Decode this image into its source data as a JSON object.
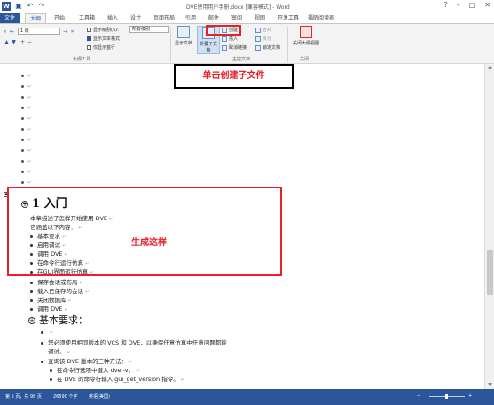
{
  "titlebar": {
    "title": "DVE使用用户手册.docx [兼容模式] - Word",
    "icons": [
      "save-icon",
      "undo-icon",
      "redo-icon"
    ]
  },
  "tabs": [
    "文件",
    "大纲",
    "开始",
    "工具箱",
    "插入",
    "设计",
    "页面布局",
    "引用",
    "邮件",
    "审阅",
    "视图",
    "开发工具",
    "福昕阅读器"
  ],
  "ribbon": {
    "level_value": "1 级",
    "show_level_label": "显示级别(S):",
    "show_level_value": "所有级别",
    "show_text_format": "显示文本格式",
    "show_first_line": "仅显示首行",
    "outline_tools_label": "大纲工具",
    "show_document": "显示文档",
    "expand_subdoc": "折叠子文档",
    "create": "创建",
    "insert": "插入",
    "unlink": "取消链接",
    "merge": "合并",
    "split": "拆分",
    "lock_document": "锁定文档",
    "master_doc_label": "主控文档",
    "close_outline": "关闭大纲视图",
    "close_label": "关闭"
  },
  "callout_text": "单击创建子文件",
  "generated_label": "生成这样",
  "doc": {
    "heading1": "1 入门",
    "lines": [
      "本章描述了怎样开始使用 DVE",
      "它涵盖以下内容：",
      "基本要求",
      "启用调试",
      "调用 DVE",
      "在命令行运行仿真",
      "在GUI界面运行仿真",
      "保存会话或布局",
      "载入已保存的会话",
      "关闭数据库",
      "调用 DVE"
    ],
    "heading2": "基本要求：",
    "body_lines": [
      "您必须使用相同版本的 VCS 和 DVE，以确保任意仿真中任意问题都能",
      "调试。",
      "查询该 DVE 版本的三种方法：",
      "在命令行选项中键入 dve -v。",
      "在 DVE 的命令行输入 gui_get_version 指令。"
    ],
    "cmd_dve": "dve -v",
    "cmd_gui": "gui_get_version"
  },
  "status": {
    "page": "第 5 页，共 98 页",
    "words": "26590 个字",
    "lang": "英语(美国)"
  }
}
